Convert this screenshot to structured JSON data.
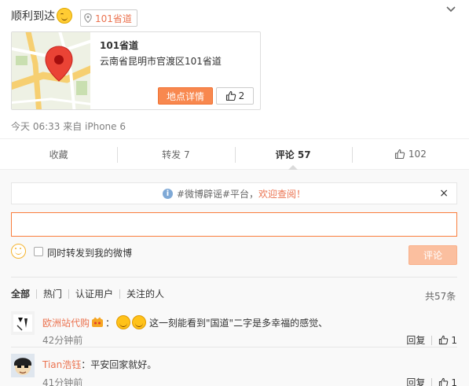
{
  "post": {
    "text": "顺利到达",
    "emoji_icon": "smile-emoji-icon",
    "location_tag": "101省道",
    "meta": "今天 06:33 来自 iPhone 6"
  },
  "location_card": {
    "title": "101省道",
    "address": "云南省昆明市官渡区101省道",
    "detail_button": "地点详情",
    "like_count": "2"
  },
  "actions": {
    "favorite": "收藏",
    "repost": "转发 7",
    "comment": "评论 57",
    "like": "102"
  },
  "notice": {
    "prefix": "#微博辟谣#平台，",
    "highlight": "欢迎查阅！",
    "close": "×"
  },
  "composer": {
    "input_value": "",
    "checkbox_label": "同时转发到我的微博",
    "submit_label": "评论"
  },
  "filters": {
    "items": [
      "全部",
      "热门",
      "认证用户",
      "关注的人"
    ],
    "total": "共57条"
  },
  "comments": [
    {
      "user": "欧洲站代购",
      "text": "这一刻能看到\"国道\"二字是多幸福的感觉、",
      "time": "42分钟前",
      "reply": "回复",
      "likes": "1"
    },
    {
      "user": "Tian浩钰",
      "text": "平安回家就好。",
      "time": "41分钟前",
      "reply": "回复",
      "likes": "1"
    }
  ],
  "colors": {
    "accent": "#eb7350",
    "button_orange": "#f8884f",
    "input_border": "#fa7d3c",
    "disabled_button": "#fbbf9f"
  }
}
